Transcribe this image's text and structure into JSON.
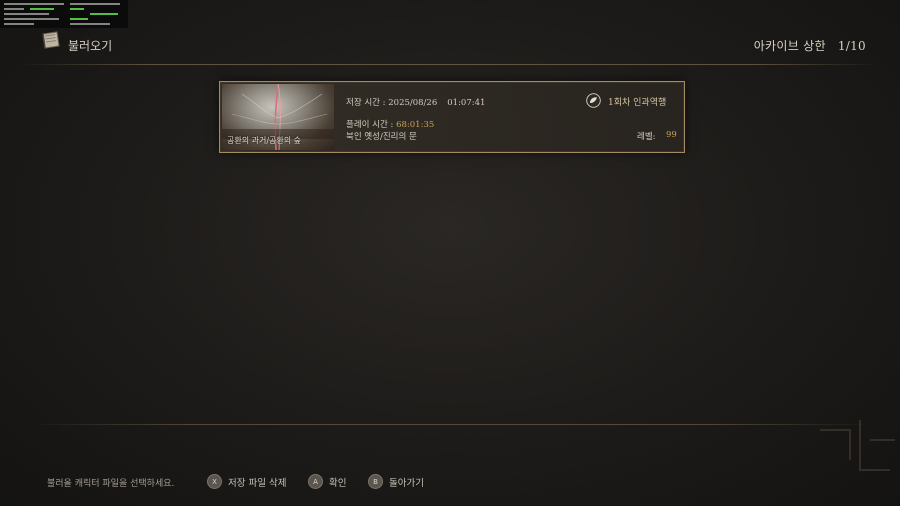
{
  "header": {
    "title": "불러오기",
    "archive_label": "아카이브 상한",
    "archive_count": "1/10"
  },
  "save_slot": {
    "thumbnail_caption": "공환의 과거/공환의 숲",
    "save_time_label": "저장 시간 : 2025/08/26",
    "save_time_clock": "01:07:41",
    "play_time_label": "플레이 시간 :",
    "play_time_value": "68:01:35",
    "location": "북인 옛성/진리의 문",
    "ng_label": "1회차 인과역행",
    "level_label": "레벨:",
    "level_value": "99"
  },
  "footer": {
    "hint": "불러올 캐릭터 파일을 선택하세요.",
    "delete": {
      "glyph": "X",
      "label": "저장 파일 삭제"
    },
    "confirm": {
      "glyph": "A",
      "label": "확인"
    },
    "back": {
      "glyph": "B",
      "label": "돌아가기"
    }
  },
  "colors": {
    "accent_gold": "#c9a25a",
    "card_border": "#a48b62",
    "overlay_green": "#5ad04a"
  },
  "icons": {
    "header": "book-icon",
    "ng": "leaf-emblem-icon"
  }
}
